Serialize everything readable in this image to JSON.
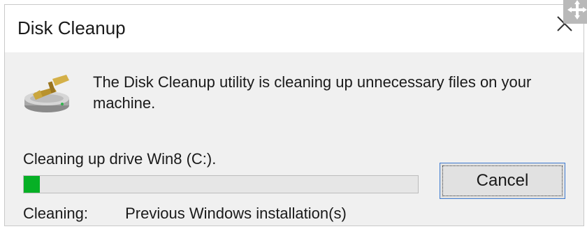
{
  "window": {
    "title": "Disk Cleanup"
  },
  "icons": {
    "app": "disk-cleanup-broom-drive-icon",
    "close": "close-x-icon",
    "move": "move-arrows-icon"
  },
  "message": {
    "text": "The Disk Cleanup utility is cleaning up unnecessary files on your machine."
  },
  "progress": {
    "status_text": "Cleaning up drive Win8 (C:).",
    "value_percent": 4,
    "fill_color": "#06b025"
  },
  "buttons": {
    "cancel_label": "Cancel"
  },
  "cleaning": {
    "label": "Cleaning:",
    "item": "Previous Windows installation(s)"
  }
}
